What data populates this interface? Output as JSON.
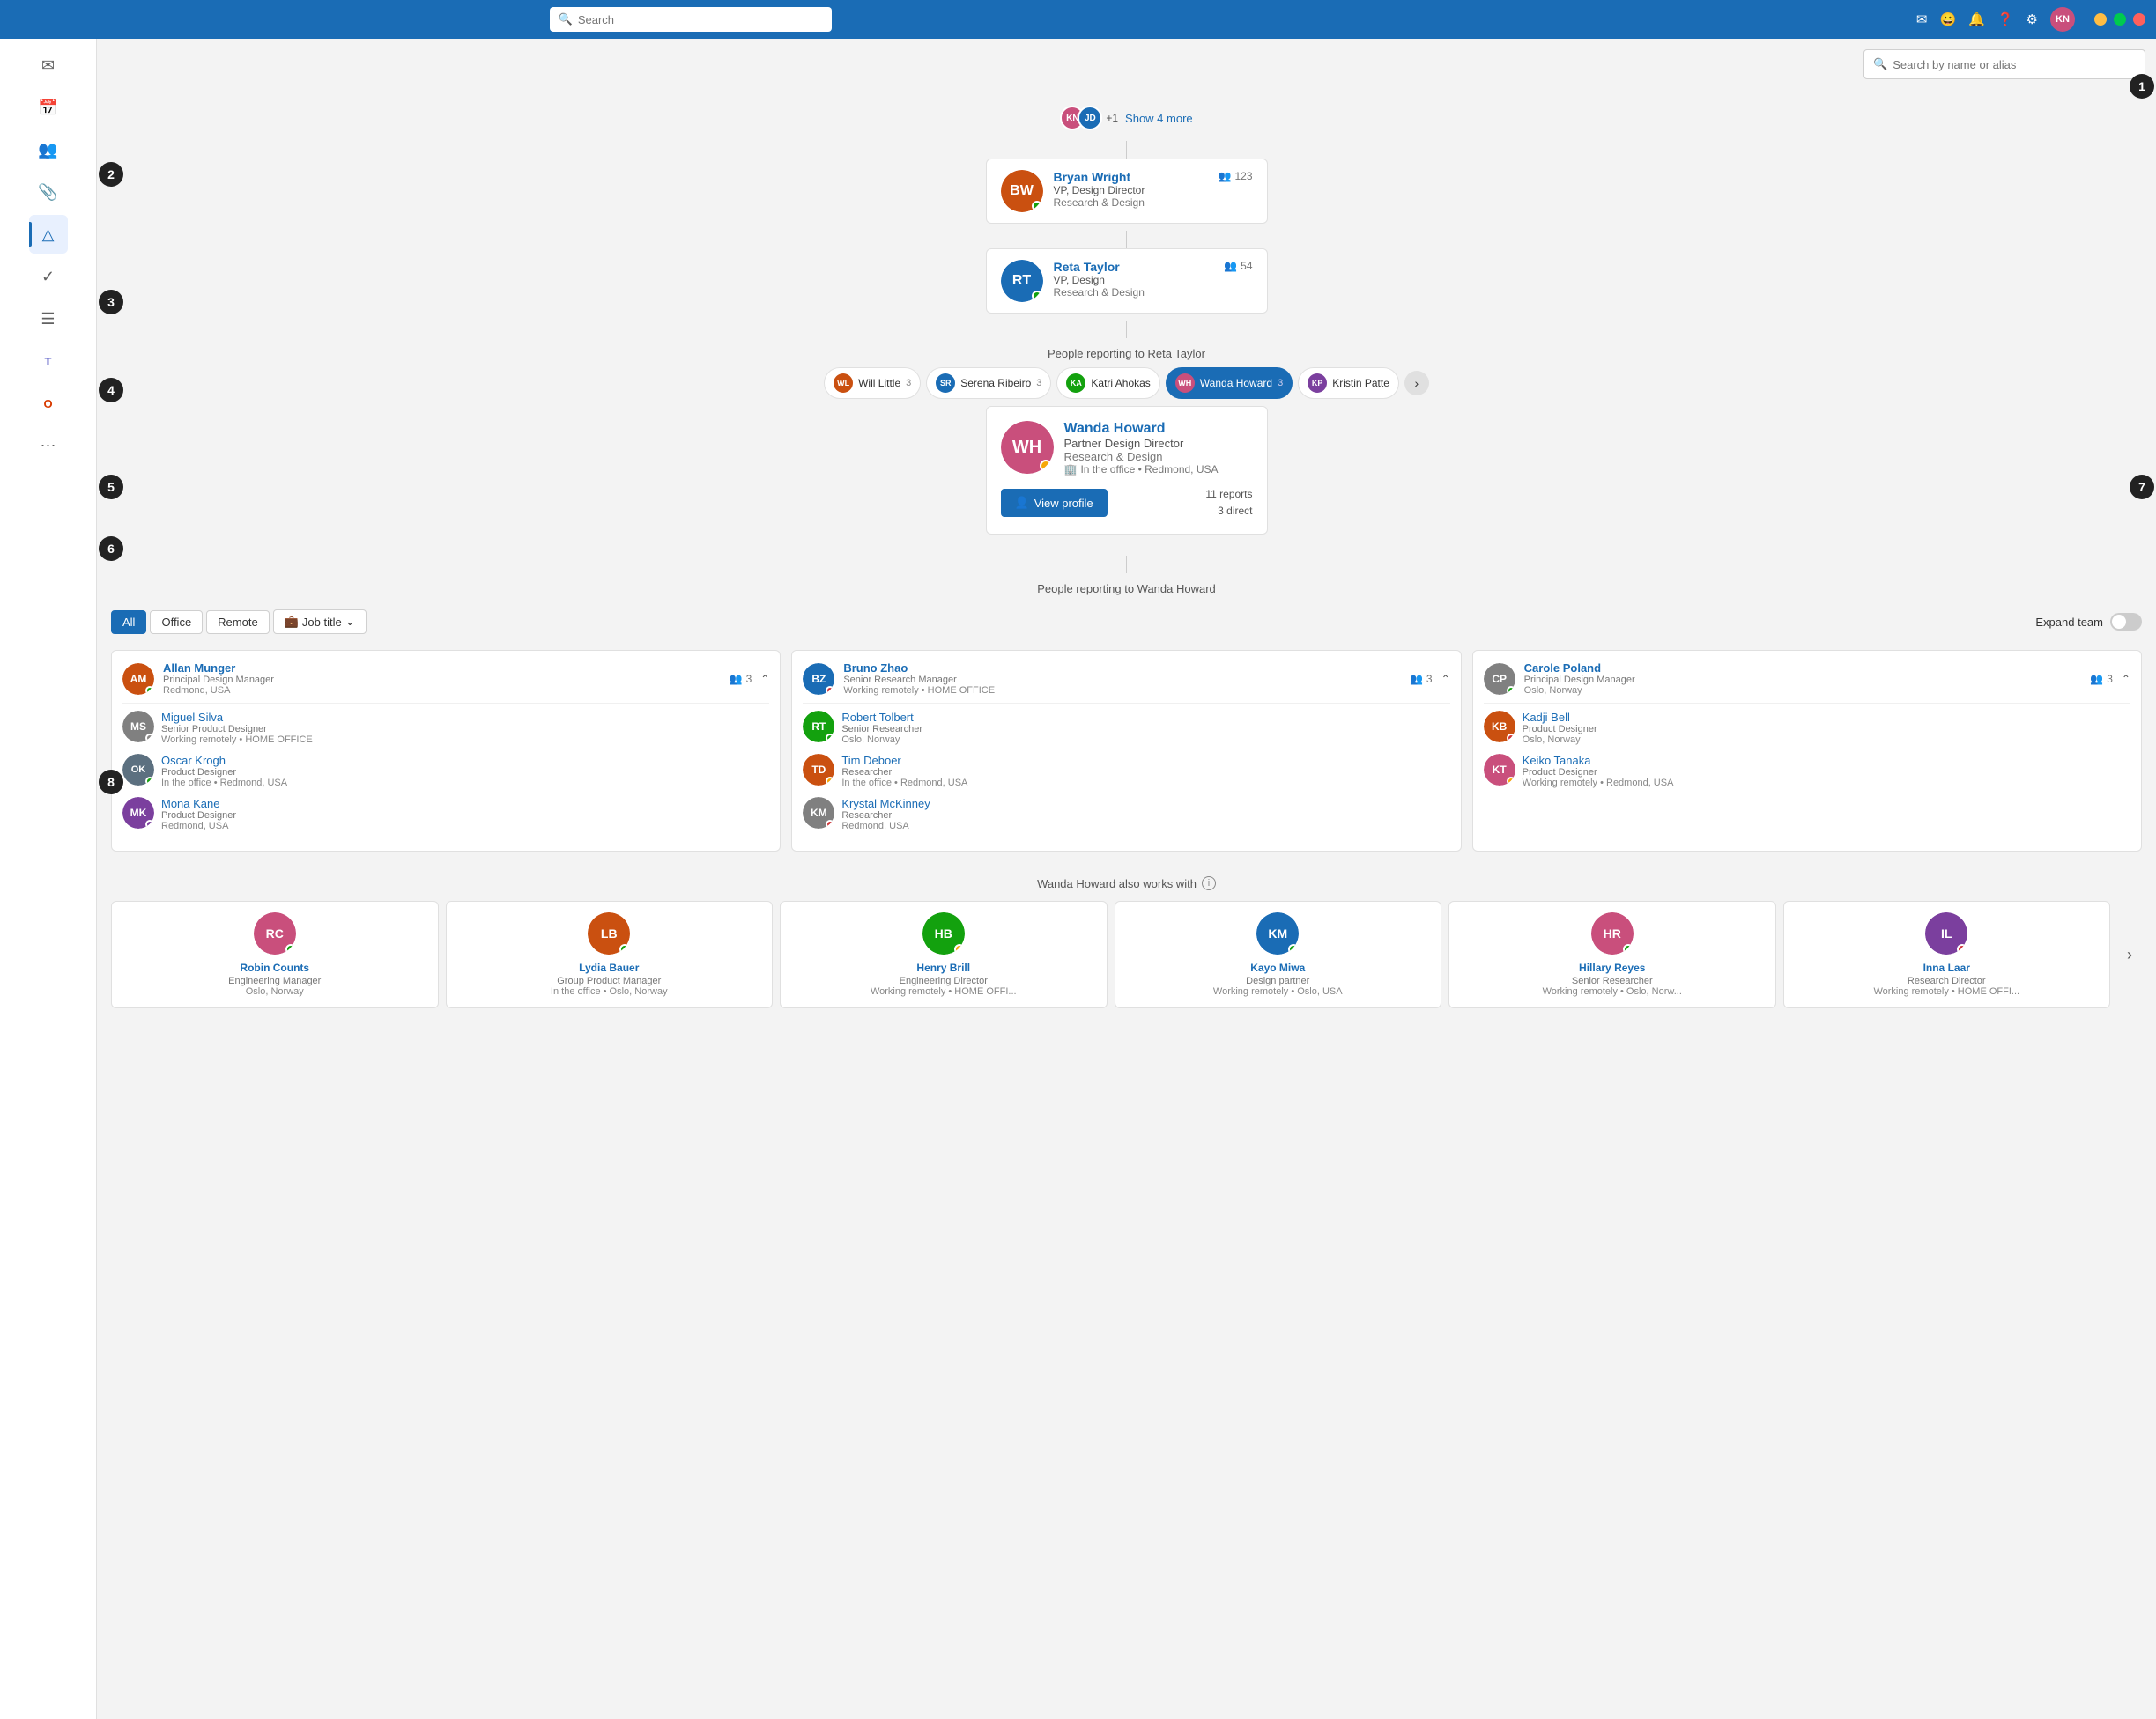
{
  "titlebar": {
    "search_placeholder": "Search",
    "icons": [
      "chat",
      "emoji",
      "bell",
      "help",
      "settings"
    ],
    "user_initials": "KN"
  },
  "top_search": {
    "placeholder": "Search by name or alias"
  },
  "show_more": {
    "label": "Show 4 more"
  },
  "hierarchy": [
    {
      "name": "Bryan Wright",
      "title": "VP, Design Director",
      "dept": "Research & Design",
      "reports": "123",
      "status": "green",
      "initials": "BW"
    },
    {
      "name": "Reta Taylor",
      "title": "VP, Design",
      "dept": "Research & Design",
      "reports": "54",
      "status": "green",
      "initials": "RT"
    }
  ],
  "reporting_to_reta": "People reporting to Reta Taylor",
  "reta_reports_tabs": [
    {
      "name": "Will Little",
      "count": "3",
      "initials": "WL",
      "color": "#ca5010"
    },
    {
      "name": "Serena Ribeiro",
      "count": "3",
      "initials": "SR",
      "color": "#1a6cb5"
    },
    {
      "name": "Katri Ahokas",
      "count": "",
      "initials": "KA",
      "color": "#13a10e"
    },
    {
      "name": "Wanda Howard",
      "count": "3",
      "initials": "WH",
      "color": "#c94f7c",
      "active": true
    },
    {
      "name": "Kristin Patte",
      "count": "",
      "initials": "KP",
      "color": "#7b3f9e"
    }
  ],
  "wanda": {
    "name": "Wanda Howard",
    "title": "Partner Design Director",
    "dept": "Research & Design",
    "location": "In the office • Redmond, USA",
    "status": "yellow",
    "initials": "WH",
    "color": "#c94f7c",
    "reports_total": "11 reports",
    "reports_direct": "3 direct",
    "view_profile": "View profile"
  },
  "reporting_to_wanda": "People reporting to Wanda Howard",
  "filter_tabs": [
    "All",
    "Office",
    "Remote"
  ],
  "filter_active": "All",
  "job_title_filter": "Job title",
  "expand_team_label": "Expand team",
  "teams": [
    {
      "manager": {
        "name": "Allan Munger",
        "title": "Principal Design Manager",
        "location": "Redmond, USA",
        "reports": "3",
        "status": "green",
        "initials": "AM",
        "color": "#ca5010"
      },
      "members": [
        {
          "name": "Miguel Silva",
          "title": "Senior Product Designer",
          "location": "Working remotely • HOME OFFICE",
          "status": "none",
          "initials": "MS",
          "color": "#808080"
        },
        {
          "name": "Oscar Krogh",
          "title": "Product Designer",
          "location": "In the office • Redmond, USA",
          "status": "green",
          "initials": "OK",
          "color": "#5c7080"
        },
        {
          "name": "Mona Kane",
          "title": "Product Designer",
          "location": "Redmond, USA",
          "status": "purple",
          "initials": "MK",
          "color": "#7b3f9e"
        }
      ]
    },
    {
      "manager": {
        "name": "Bruno Zhao",
        "title": "Senior Research Manager",
        "location": "Working remotely • HOME OFFICE",
        "reports": "3",
        "status": "red",
        "initials": "BZ",
        "color": "#1a6cb5"
      },
      "members": [
        {
          "name": "Robert Tolbert",
          "title": "Senior Researcher",
          "location": "Oslo, Norway",
          "status": "green",
          "initials": "RT",
          "color": "#13a10e"
        },
        {
          "name": "Tim Deboer",
          "title": "Researcher",
          "location": "In the office • Redmond, USA",
          "status": "yellow",
          "initials": "TD",
          "color": "#ca5010"
        },
        {
          "name": "Krystal McKinney",
          "title": "Researcher",
          "location": "Redmond, USA",
          "status": "red",
          "initials": "KM",
          "color": "#808080"
        }
      ]
    },
    {
      "manager": {
        "name": "Carole Poland",
        "title": "Principal Design Manager",
        "location": "Oslo, Norway",
        "reports": "3",
        "status": "green",
        "initials": "CP",
        "color": "#808080"
      },
      "members": [
        {
          "name": "Kadji Bell",
          "title": "Product Designer",
          "location": "Oslo, Norway",
          "status": "red",
          "initials": "KB",
          "color": "#ca5010"
        },
        {
          "name": "Keiko Tanaka",
          "title": "Product Designer",
          "location": "Working remotely • Redmond, USA",
          "status": "yellow",
          "initials": "KT",
          "color": "#c94f7c"
        }
      ]
    }
  ],
  "also_works_with_label": "Wanda Howard also works with",
  "collaborators": [
    {
      "name": "Robin Counts",
      "title": "Engineering Manager",
      "location": "Oslo, Norway",
      "initials": "RC",
      "color": "#c94f7c",
      "status": "green"
    },
    {
      "name": "Lydia Bauer",
      "title": "Group Product Manager",
      "location": "In the office • Oslo, Norway",
      "initials": "LB",
      "color": "#ca5010",
      "status": "green"
    },
    {
      "name": "Henry Brill",
      "title": "Engineering Director",
      "location": "Working remotely • HOME OFFI...",
      "initials": "HB",
      "color": "#13a10e",
      "status": "yellow"
    },
    {
      "name": "Kayo Miwa",
      "title": "Design partner",
      "location": "Working remotely • Oslo, USA",
      "initials": "KM",
      "color": "#1a6cb5",
      "status": "green"
    },
    {
      "name": "Hillary Reyes",
      "title": "Senior Researcher",
      "location": "Working remotely • Oslo, Norw...",
      "initials": "HR",
      "color": "#c94f7c",
      "status": "green"
    },
    {
      "name": "Inna Laar",
      "title": "Research Director",
      "location": "Working remotely • HOME OFFI...",
      "initials": "IL",
      "color": "#7b3f9e",
      "status": "red"
    }
  ],
  "sidebar_icons": [
    "mail",
    "calendar",
    "people-group",
    "attachment",
    "org-chart",
    "checkmark",
    "list",
    "teams",
    "office",
    "more"
  ],
  "numbered_labels": [
    "1",
    "2",
    "3",
    "4",
    "5",
    "6",
    "7",
    "8"
  ]
}
